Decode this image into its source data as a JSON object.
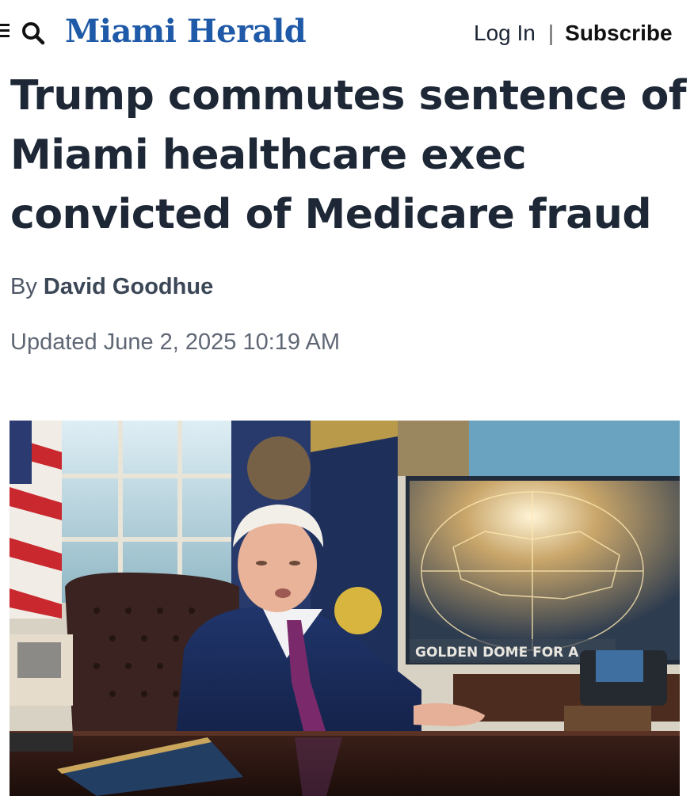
{
  "header": {
    "logo_text": "Miami Herald",
    "login_label": "Log In",
    "separator": "|",
    "subscribe_label": "Subscribe",
    "menu_icon": "menu-icon",
    "search_icon": "search-icon"
  },
  "article": {
    "headline": "Trump commutes sentence of Miami healthcare exec convicted of Medicare fraud",
    "byline_prefix": "By",
    "author": "David Goodhue",
    "updated": "Updated June 2, 2025 10:19 AM"
  },
  "photo": {
    "screen_text": "GOLDEN DOME FOR A"
  },
  "colors": {
    "brand": "#1f5aa8",
    "headline": "#1d2736"
  }
}
